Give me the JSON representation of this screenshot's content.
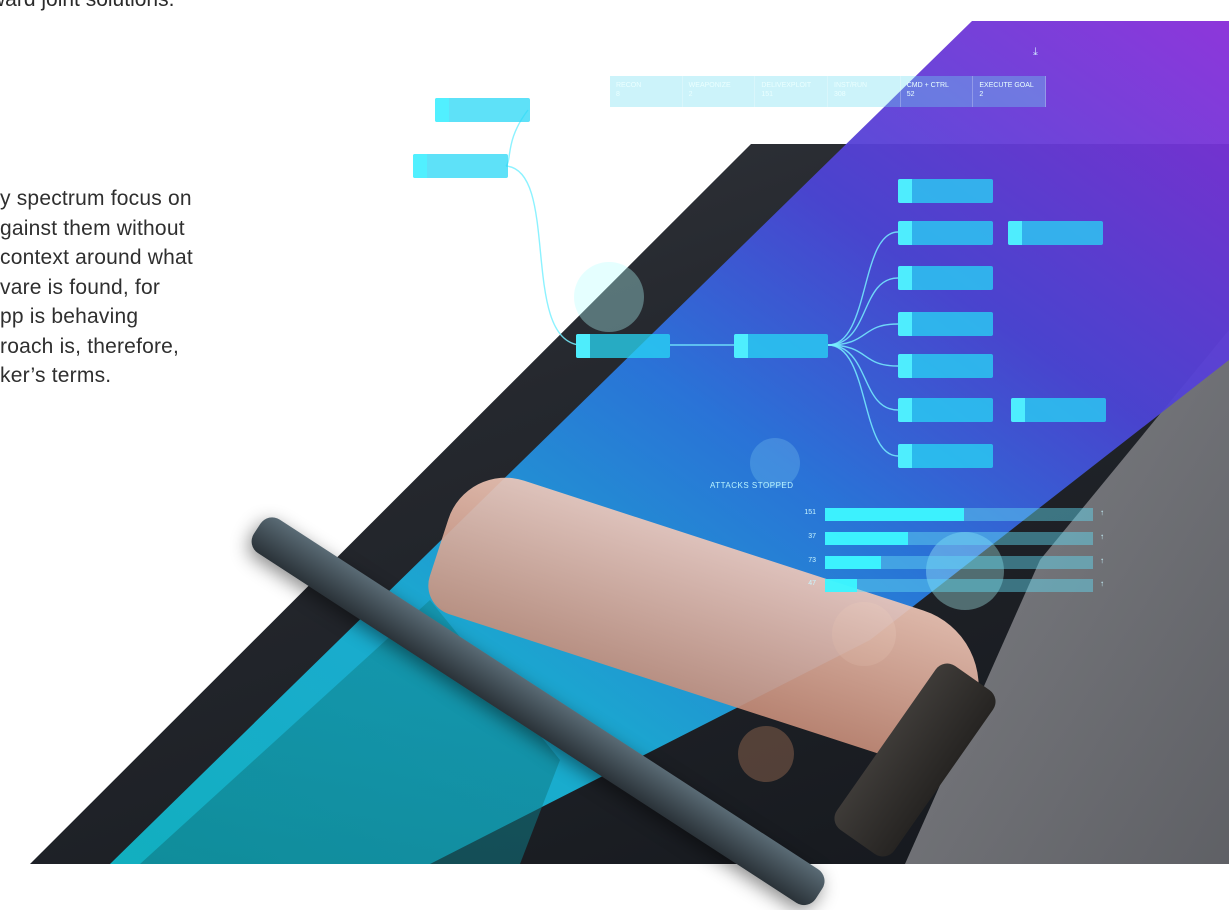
{
  "text": {
    "top_line": "ward joint solutions.",
    "paragraph_lines": [
      "y spectrum focus on",
      "gainst them without",
      "context around what",
      "vare is found, for",
      "pp is behaving",
      "roach is, therefore,",
      "ker’s terms."
    ]
  },
  "dashboard": {
    "kill_chain": [
      {
        "label": "RECON",
        "count": "8"
      },
      {
        "label": "WEAPONIZE",
        "count": "2"
      },
      {
        "label": "DELIVEXPLOIT",
        "count": "151"
      },
      {
        "label": "INST/RUN",
        "count": "308"
      },
      {
        "label": "CMD + CTRL",
        "count": "52"
      },
      {
        "label": "EXECUTE GOAL",
        "count": "2"
      }
    ],
    "attacks_title": "ATTACKS STOPPED",
    "attacks": [
      {
        "value": "151",
        "fraction": 0.52
      },
      {
        "value": "37",
        "fraction": 0.31
      },
      {
        "value": "73",
        "fraction": 0.21
      },
      {
        "value": "47",
        "fraction": 0.12
      }
    ],
    "icons": {
      "download": "download-icon"
    }
  },
  "colors": {
    "gradient_start": "#0fb7c4",
    "gradient_end": "#8a2bd8",
    "node_fill": "#28d7f5"
  }
}
